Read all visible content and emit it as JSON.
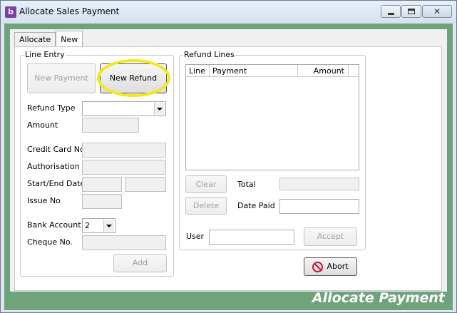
{
  "window": {
    "title": "Allocate Sales Payment",
    "app_icon_glyph": "b",
    "app_icon_color": "#7b3fa5",
    "close_glyph": "✕"
  },
  "tabs": [
    {
      "label": "Allocate"
    },
    {
      "label": "New"
    }
  ],
  "line_entry": {
    "title": "Line Entry",
    "new_payment_label": "New Payment",
    "new_refund_label": "New Refund",
    "refund_type_label": "Refund Type",
    "refund_type_value": "",
    "amount_label": "Amount",
    "credit_card_label": "Credit Card No",
    "authorisation_label": "Authorisation",
    "start_end_label": "Start/End Date",
    "issue_no_label": "Issue No",
    "bank_account_label": "Bank Account",
    "bank_account_value": "2",
    "cheque_no_label": "Cheque No.",
    "add_label": "Add"
  },
  "refund_lines": {
    "title": "Refund Lines",
    "columns": [
      "Line",
      "Payment",
      "Amount"
    ],
    "rows": [],
    "clear_label": "Clear",
    "delete_label": "Delete",
    "total_label": "Total",
    "date_paid_label": "Date Paid",
    "user_label": "User",
    "accept_label": "Accept"
  },
  "abort_label": "Abort",
  "brand_text": "Allocate Payment",
  "colors": {
    "frame_green": "#6fa37b",
    "highlight": "#f4e81c",
    "abort_red": "#c8102e"
  }
}
